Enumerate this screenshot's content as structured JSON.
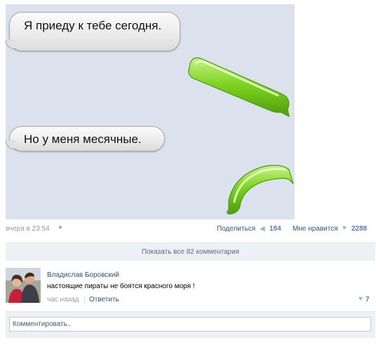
{
  "post": {
    "messages": [
      {
        "text": "Я приеду к тебе сегодня."
      },
      {
        "text": "Но у меня месячные."
      }
    ],
    "date": "вчера в 23:54",
    "platform_icon": "apple-icon",
    "share_label": "Поделиться",
    "share_count": "184",
    "like_label": "Мне нравится",
    "like_count": "2288"
  },
  "comments": {
    "show_all_label": "Показать все 82 комментария",
    "items": [
      {
        "author": "Владислав Боровский",
        "text": "настоящие пираты не боятся красного моря !",
        "time": "час назад",
        "reply_label": "Ответить",
        "like_count": "7"
      }
    ],
    "input_placeholder": "Комментировать.."
  },
  "colors": {
    "link": "#2b587a",
    "count": "#5b7fa6",
    "panel": "#edf0f4",
    "photo_bg": "#dbe2ee",
    "green_bubble": "#7ed321"
  }
}
